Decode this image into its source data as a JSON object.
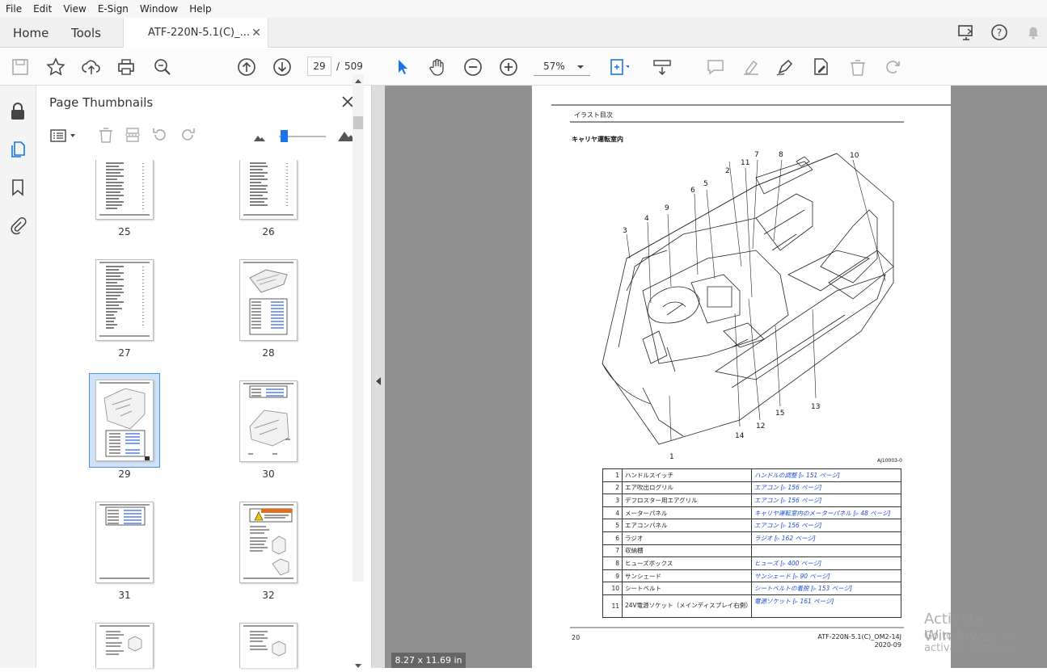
{
  "menu": [
    "File",
    "Edit",
    "View",
    "E-Sign",
    "Window",
    "Help"
  ],
  "tabs": {
    "home": "Home",
    "tools": "Tools",
    "doc": "ATF-220N-5.1(C)_..."
  },
  "toolbar": {
    "page_current": "29",
    "page_sep": "/",
    "page_total": "509",
    "zoom": "57%"
  },
  "panel": {
    "title": "Page Thumbnails",
    "thumbnails": [
      {
        "label": "25"
      },
      {
        "label": "26"
      },
      {
        "label": "27"
      },
      {
        "label": "28"
      },
      {
        "label": "29"
      },
      {
        "label": "30"
      },
      {
        "label": "31"
      },
      {
        "label": "32"
      }
    ]
  },
  "viewer": {
    "size_badge": "8.27 x 11.69 in"
  },
  "document": {
    "header": "イラスト目次",
    "section_title": "キャリヤ運転室内",
    "figure_code": "AJ10003-0",
    "callouts": [
      "1",
      "2",
      "3",
      "4",
      "5",
      "6",
      "7",
      "8",
      "9",
      "10",
      "11",
      "12",
      "13",
      "14",
      "15"
    ],
    "legend": [
      {
        "num": "1",
        "desc": "ハンドルスイッチ",
        "ref": "ハンドルの調整 [▹ 151 ページ]"
      },
      {
        "num": "2",
        "desc": "エア吹出ログリル",
        "ref": "エアコン [▹ 156 ページ]"
      },
      {
        "num": "3",
        "desc": "デフロスター用エアグリル",
        "ref": "エアコン [▹ 156 ページ]"
      },
      {
        "num": "4",
        "desc": "メーターパネル",
        "ref": "キャリヤ運転室内のメーターパネル [▹ 48 ページ]"
      },
      {
        "num": "5",
        "desc": "エアコンパネル",
        "ref": "エアコン [▹ 156 ページ]"
      },
      {
        "num": "6",
        "desc": "ラジオ",
        "ref": "ラジオ [▹ 162 ページ]"
      },
      {
        "num": "7",
        "desc": "収納棚",
        "ref": ""
      },
      {
        "num": "8",
        "desc": "ヒューズボックス",
        "ref": "ヒューズ [▹ 400 ページ]"
      },
      {
        "num": "9",
        "desc": "サンシェード",
        "ref": "サンシェード [▹ 90 ページ]"
      },
      {
        "num": "10",
        "desc": "シートベルト",
        "ref": "シートベルトの着脱 [▹ 153 ページ]"
      },
      {
        "num": "11",
        "desc": "24V電源ソケット（メインディスプレイ右側）",
        "ref": "電源ソケット [▹ 161 ページ]"
      }
    ],
    "page_number": "20",
    "doc_code": "ATF-220N-5.1(C)_OM2-14J",
    "doc_date": "2020-09"
  },
  "watermark": {
    "line1": "Activate Windows",
    "line2": "Go to Settings to activate Windows."
  }
}
